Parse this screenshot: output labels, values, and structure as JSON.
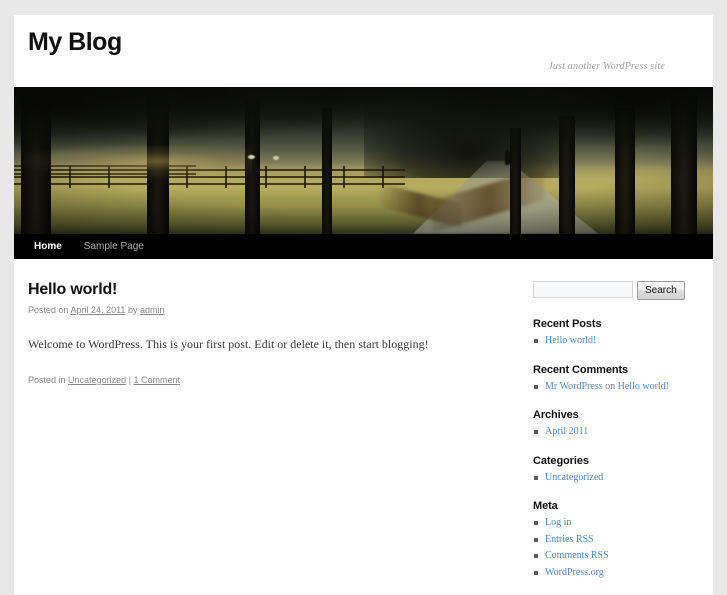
{
  "site": {
    "title": "My Blog",
    "description": "Just another WordPress site"
  },
  "header_image": {
    "name": "tree-lined-path-photo",
    "alt": "Tree-lined path through a field with a wooden fence"
  },
  "nav": {
    "items": [
      {
        "label": "Home",
        "current": true
      },
      {
        "label": "Sample Page",
        "current": false
      }
    ]
  },
  "post": {
    "title": "Hello world!",
    "meta": {
      "posted_on_prefix": "Posted on",
      "date": "April 24, 2011",
      "by": "by",
      "author": "admin"
    },
    "content": "Welcome to WordPress. This is your first post. Edit or delete it, then start blogging!",
    "footer": {
      "posted_in_prefix": "Posted in",
      "category": "Uncategorized",
      "separator": "|",
      "comments": "1 Comment"
    }
  },
  "sidebar": {
    "search": {
      "value": "",
      "placeholder": "",
      "button_label": "Search"
    },
    "widgets": [
      {
        "title": "Recent Posts",
        "items": [
          {
            "text": "Hello world!"
          }
        ]
      },
      {
        "title": "Recent Comments",
        "items": [
          {
            "author": "Mr WordPress",
            "on": "on",
            "post": "Hello world!"
          }
        ]
      },
      {
        "title": "Archives",
        "items": [
          {
            "text": "April 2011"
          }
        ]
      },
      {
        "title": "Categories",
        "items": [
          {
            "text": "Uncategorized"
          }
        ]
      },
      {
        "title": "Meta",
        "items": [
          {
            "text": "Log in"
          },
          {
            "text": "Entries RSS"
          },
          {
            "text": "Comments RSS"
          },
          {
            "text": "WordPress.org"
          }
        ]
      }
    ]
  },
  "colors": {
    "link": "#4b87c9",
    "text": "#373737",
    "muted": "#888888",
    "nav_background": "#000000",
    "page_background": "#ffffff",
    "canvas_background": "#e8e8e8"
  }
}
